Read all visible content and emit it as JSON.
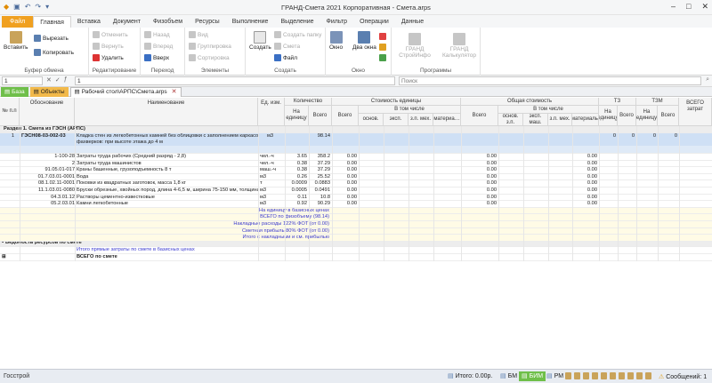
{
  "window": {
    "title": "ГРАНД-Смета 2021 Корпоративная - Смета.arps",
    "controls": [
      "–",
      "□",
      "✕"
    ]
  },
  "ribbon_tabs": [
    "Файл",
    "Главная",
    "Вставка",
    "Документ",
    "Физобъем",
    "Ресурсы",
    "Выполнение",
    "Выделение",
    "Фильтр",
    "Операции",
    "Данные"
  ],
  "ribbon": {
    "clipboard": {
      "label": "Буфер обмена",
      "paste": "Вставить",
      "cut": "Вырезать",
      "copy": "Копировать"
    },
    "edit": {
      "label": "Редактирование",
      "undo": "Отменить",
      "redo": "Вернуть",
      "delete": "Удалить"
    },
    "nav": {
      "label": "Переход",
      "back": "Назад",
      "forward": "Вперед",
      "up": "Вверх"
    },
    "elements": {
      "label": "Элементы",
      "view": "Вид",
      "group": "Группировка",
      "sort": "Сортировка"
    },
    "create": {
      "label": "Создать",
      "create": "Создать",
      "folder": "Создать папку",
      "estimate": "Смета",
      "file": "Файл"
    },
    "window": {
      "label": "Окно",
      "window": "Окно",
      "two": "Два окна"
    },
    "programs": {
      "label": "Программы",
      "stroyinfo": "ГРАНД СтройИнфо",
      "calc": "ГРАНД Калькулятор"
    }
  },
  "formula_bar": {
    "cell_ref": "1",
    "formula": "1",
    "search_placeholder": "Поиск"
  },
  "doc_tabs": {
    "base": "База",
    "objects": "Объекты",
    "current": "Рабочий стол\\АРПС\\Смета.arps"
  },
  "headers": {
    "num": "№ п.п",
    "basis": "Обоснование",
    "name": "Наименование",
    "unit": "Ед. изм.",
    "qty": "Количество",
    "qty_per": "На единицу",
    "qty_total": "Всего",
    "unit_cost": "Стоимость единицы",
    "total": "Всего",
    "incl": "В том числе",
    "osnov": "основ.",
    "eksp": "эксп.",
    "zp_meh": "з.п. мех.",
    "mater": "материа…",
    "total_cost": "Общая стоимость",
    "osnov_zp": "основ. з.п.",
    "eksp_mash": "эксп. маш.",
    "zp_meh2": "з.п. мех.",
    "materials": "материалы",
    "tz": "ТЗ",
    "tz_per": "На единицу",
    "tz_total": "Всего",
    "tzm": "ТЗМ",
    "tzm_per": "На единицу",
    "tzm_total": "Всего",
    "total_labor": "ВСЕГО затрат"
  },
  "section_title": "Раздел 1. Смета из ГЭСН (АРПС)",
  "main_row": {
    "num": "1",
    "basis": "ГЭСН08-03-002-03",
    "name1": "Кладка стен из легкобетонных камней без облицовки с заполнением каркасов и",
    "name2": "фахверков: при высоте этажа до 4 м",
    "unit": "м3",
    "qty_total": "98.14",
    "tz_per": "0",
    "tz_total": "0",
    "tzm_per": "0",
    "tzm_total": "0"
  },
  "resources": [
    {
      "code": "1-100-28",
      "name": "Затраты труда рабочих (Средний разряд - 2,8)",
      "unit": "чел.-ч",
      "per": "3.65",
      "total": "358.2",
      "cost": "0.00",
      "gcost": "0.00",
      "mat": "0.00"
    },
    {
      "code": "2",
      "name": "Затраты труда машинистов",
      "unit": "чел.-ч",
      "per": "0.38",
      "total": "37.29",
      "cost": "0.00",
      "gcost": "0.00",
      "mat": "0.00"
    },
    {
      "code": "91.05.01-017",
      "name": "Краны башенные, грузоподъемность 8 т",
      "unit": "маш.-ч",
      "per": "0.38",
      "total": "37.29",
      "cost": "0.00",
      "gcost": "0.00",
      "mat": "0.00"
    },
    {
      "code": "01.7.03.01-0001",
      "name": "Вода",
      "unit": "м3",
      "per": "0.26",
      "total": "25.52",
      "cost": "0.00",
      "gcost": "0.00",
      "mat": "0.00"
    },
    {
      "code": "08.1.02.11-0001",
      "name": "Поковки из квадратных заготовок, масса 1,8 кг",
      "unit": "т",
      "per": "0.0009",
      "total": "0.0883",
      "cost": "0.00",
      "gcost": "0.00",
      "mat": "0.00"
    },
    {
      "code": "11.1.03.01-0080",
      "name": "Бруски обрезные, хвойных пород, длина 4-6,5 м, ширина 75-150 мм, толщина …",
      "unit": "м3",
      "per": "0.0005",
      "total": "0.0491",
      "cost": "0.00",
      "gcost": "0.00",
      "mat": "0.00"
    },
    {
      "code": "04.3.01.12",
      "name": "Растворы цементно-известковые",
      "unit": "м3",
      "per": "0.11",
      "total": "10.8",
      "cost": "0.00",
      "gcost": "0.00",
      "mat": "0.00"
    },
    {
      "code": "05.2.03.01",
      "name": "Камни легкобетонные",
      "unit": "м3",
      "per": "0.92",
      "total": "90.29",
      "cost": "0.00",
      "gcost": "0.00",
      "mat": "0.00"
    }
  ],
  "summaries": [
    {
      "label": "На единицу в базисных ценах"
    },
    {
      "label": "ВСЕГО по физобъему (98.14)"
    },
    {
      "label": "Накладные расходы 122% ФОТ (от 0.00)"
    },
    {
      "label": "Сметная прибыль 80% ФОТ (от 0.00)"
    },
    {
      "label": "Итого с накладными и см. прибылью"
    }
  ],
  "ved": {
    "title": "Ведомость ресурсов по смете",
    "line1": "Итого прямые затраты по смете в базисных ценах",
    "line2": "ВСЕГО по смете"
  },
  "status": {
    "left": "Госстрой",
    "itog": "Итого: 0.00р.",
    "bm": "БМ",
    "bim": "БИМ",
    "rm": "РМ",
    "messages": "Сообщений: 1"
  }
}
